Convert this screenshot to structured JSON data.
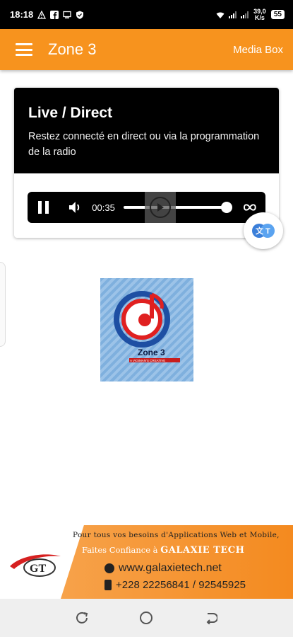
{
  "status_bar": {
    "time": "18:18",
    "network_speed": "39,0 K/s",
    "battery": "55",
    "left_icons": [
      "warning-icon",
      "facebook-icon",
      "cast-icon",
      "shield-icon"
    ],
    "right_icons": [
      "wifi-icon",
      "signal-icon",
      "signal-icon"
    ]
  },
  "app_bar": {
    "title": "Zone 3",
    "action_label": "Media Box",
    "color": "#f7931e"
  },
  "live_card": {
    "title": "Live / Direct",
    "subtitle": "Restez connecté en direct ou via la programmation de la radio"
  },
  "player": {
    "elapsed": "00:35",
    "progress_fraction": 1.0
  },
  "logo": {
    "text": "Zone 3",
    "tagline": "A VIGIMAN'S CREATIVE"
  },
  "banner": {
    "line1": "Pour tous vos besoins d'Applications Web et Mobile,",
    "line2_prefix": "Faites Confiance à",
    "line2_brand": "GALAXIE TECH",
    "website": "www.galaxietech.net",
    "phone": "+228 22256841 / 92545925",
    "logo_text": "GT"
  }
}
